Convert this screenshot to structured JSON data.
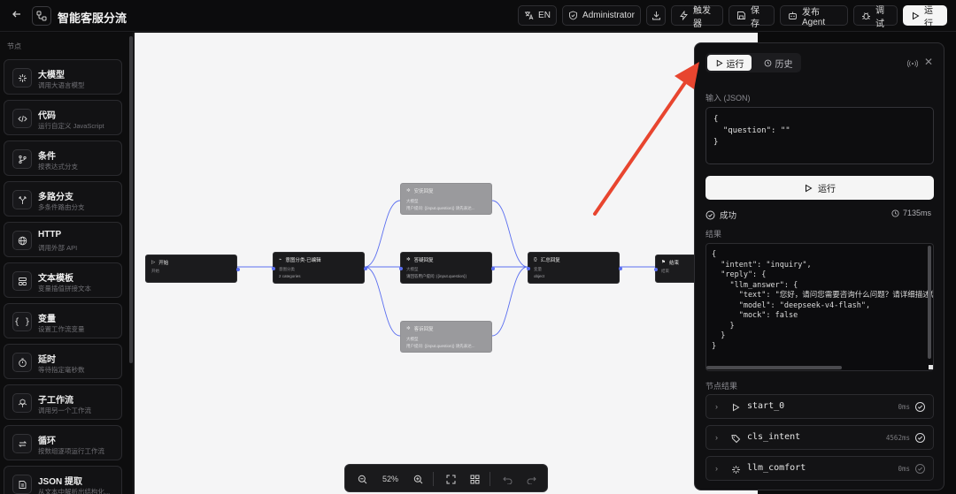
{
  "header": {
    "title": "智能客服分流",
    "lang_label": "EN",
    "user_label": "Administrator",
    "trigger_label": "触发器",
    "save_label": "保存",
    "publish_label": "发布 Agent",
    "debug_label": "调试",
    "run_label": "运行"
  },
  "sidebar": {
    "section_label": "节点",
    "items": [
      {
        "name": "大模型",
        "desc": "调用大语言模型",
        "icon": "sparkle-icon"
      },
      {
        "name": "代码",
        "desc": "运行自定义 JavaScript",
        "icon": "code-icon"
      },
      {
        "name": "条件",
        "desc": "按表达式分支",
        "icon": "branch-icon"
      },
      {
        "name": "多路分支",
        "desc": "多条件路由分支",
        "icon": "split-icon"
      },
      {
        "name": "HTTP",
        "desc": "调用外部 API",
        "icon": "globe-icon"
      },
      {
        "name": "文本模板",
        "desc": "变量插值拼接文本",
        "icon": "template-icon"
      },
      {
        "name": "变量",
        "desc": "设置工作流变量",
        "icon": "braces-icon"
      },
      {
        "name": "延时",
        "desc": "等待指定毫秒数",
        "icon": "timer-icon"
      },
      {
        "name": "子工作流",
        "desc": "调用另一个工作流",
        "icon": "subflow-icon"
      },
      {
        "name": "循环",
        "desc": "按数组逐项运行工作流",
        "icon": "loop-icon"
      },
      {
        "name": "JSON 提取",
        "desc": "从文本中解析出结构化...",
        "icon": "json-icon"
      }
    ]
  },
  "canvas": {
    "nodes": {
      "start": {
        "title": "开始",
        "line1": "开始",
        "line2": ""
      },
      "classify": {
        "title": "意图分类-已编辑",
        "line1": "意图分类",
        "line2": "2 categories"
      },
      "comfort": {
        "title": "安抚回复",
        "line1": "大模型",
        "line2": "用户提问: {{input.question}} 请先表达..."
      },
      "answer": {
        "title": "答疑回复",
        "line1": "大模型",
        "line2": "请回答用户提问: {{input.question}}"
      },
      "complaint": {
        "title": "客诉回复",
        "line1": "大模型",
        "line2": "用户提问: {{input.question}} 请先表达..."
      },
      "merge": {
        "title": "汇总回复",
        "line1": "变量",
        "line2": "object"
      },
      "end": {
        "title": "结束",
        "line1": "结束",
        "line2": ""
      }
    },
    "zoom_label": "52%"
  },
  "panel": {
    "tab_run": "运行",
    "tab_history": "历史",
    "input_label": "输入 (JSON)",
    "input_value": "{\n  \"question\": \"\"\n}",
    "run_button": "运行",
    "status": "成功",
    "duration": "7135ms",
    "result_label": "结果",
    "result_value": "{\n  \"intent\": \"inquiry\",\n  \"reply\": {\n    \"llm_answer\": {\n      \"text\": \"您好，请问您需要咨询什么问题？请详细描述您\n      \"model\": \"deepseek-v4-flash\",\n      \"mock\": false\n    }\n  }\n}",
    "node_results_label": "节点结果",
    "node_results": [
      {
        "name": "start_0",
        "ms": "0ms",
        "icon": "play-icon"
      },
      {
        "name": "cls_intent",
        "ms": "4562ms",
        "icon": "tag-icon"
      },
      {
        "name": "llm_comfort",
        "ms": "0ms",
        "icon": "sparkle-icon"
      }
    ]
  },
  "colors": {
    "edge": "#5b6ff0",
    "arrow": "#e8452f",
    "accent": "#f5f5f5"
  }
}
